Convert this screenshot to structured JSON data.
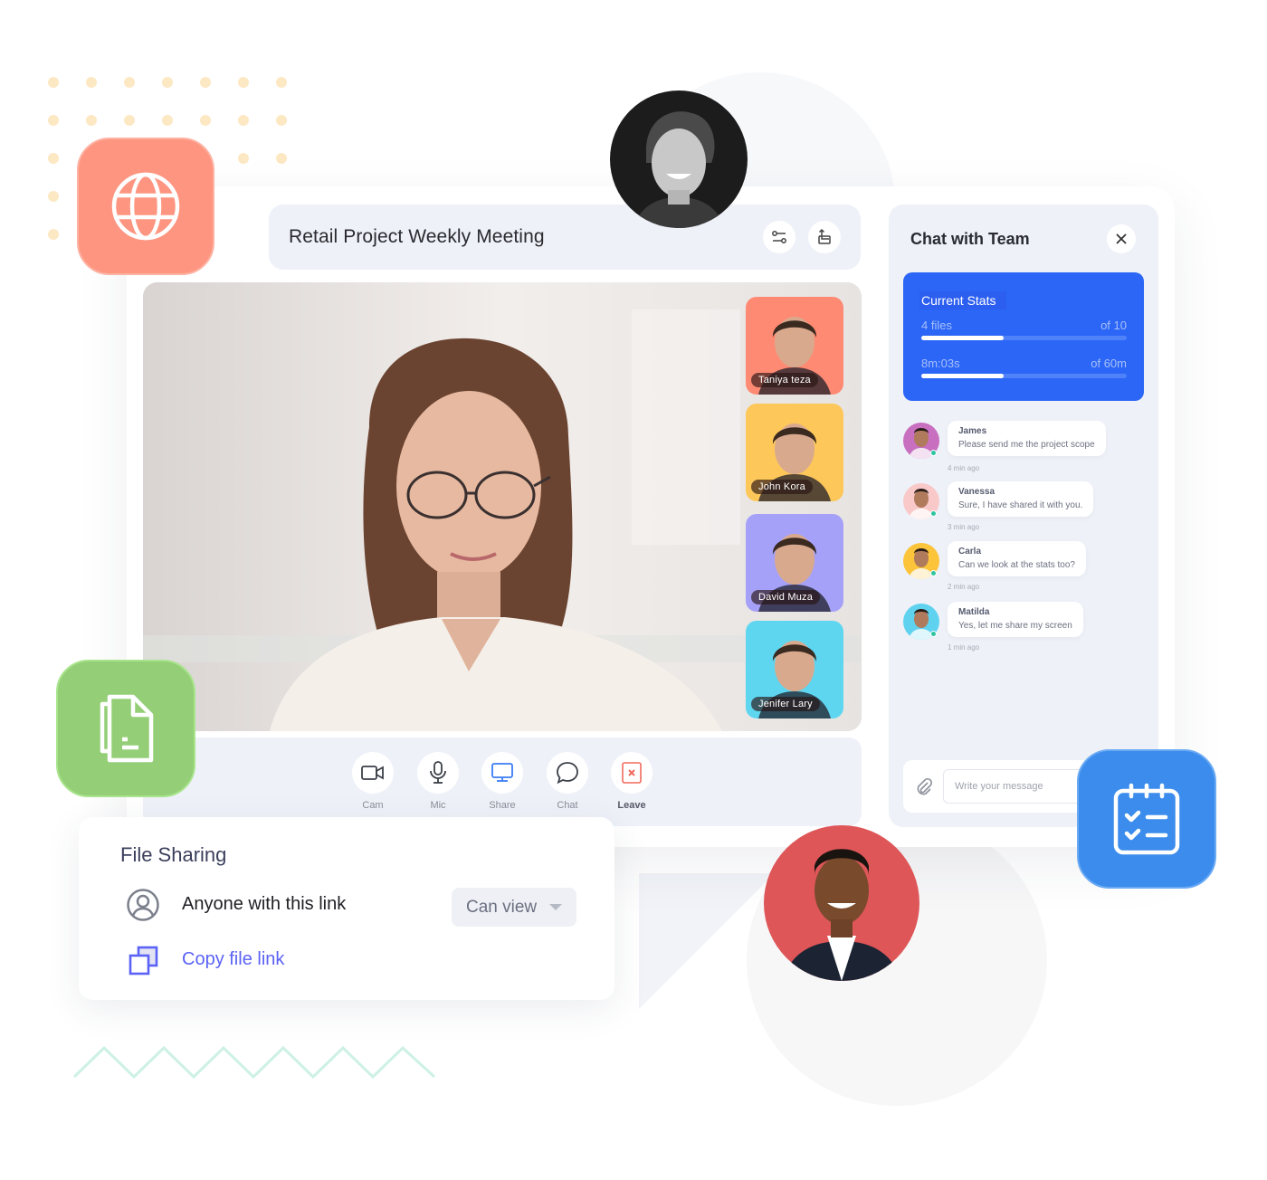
{
  "meeting": {
    "title": "Retail Project Weekly Meeting",
    "header_buttons": [
      {
        "icon": "sliders-icon"
      },
      {
        "icon": "share-export-icon"
      }
    ]
  },
  "participants": [
    {
      "name": "Taniya teza",
      "bg": "#fe8a73"
    },
    {
      "name": "John Kora",
      "bg": "#fdc75a"
    },
    {
      "name": "David Muza",
      "bg": "#a5a1f8"
    },
    {
      "name": "Jenifer Lary",
      "bg": "#5fd6f0"
    }
  ],
  "controls": [
    {
      "label": "Cam",
      "icon": "video-camera-icon"
    },
    {
      "label": "Mic",
      "icon": "microphone-icon"
    },
    {
      "label": "Share",
      "icon": "screen-share-icon",
      "color": "#3b7cf4"
    },
    {
      "label": "Chat",
      "icon": "chat-bubble-icon"
    },
    {
      "label": "Leave",
      "icon": "leave-icon",
      "color": "#f06a5b"
    }
  ],
  "chat": {
    "title": "Chat with Team",
    "stats": {
      "title": "Current Stats",
      "files": {
        "label": "4 files",
        "total_label": "of 10",
        "progress": 0.4
      },
      "time": {
        "label": "8m:03s",
        "total_label": "of 60m",
        "progress": 0.4
      }
    },
    "messages": [
      {
        "name": "James",
        "text": "Please send me the project scope",
        "time": "4 min ago",
        "avatar_bg": "#c86fc0"
      },
      {
        "name": "Vanessa",
        "text": "Sure, I have shared it with you.",
        "time": "3 min ago",
        "avatar_bg": "#f9c9c9"
      },
      {
        "name": "Carla",
        "text": "Can we look at the stats too?",
        "time": "2 min ago",
        "avatar_bg": "#fbc43a"
      },
      {
        "name": "Matilda",
        "text": "Yes, let me share my screen",
        "time": "1 min ago",
        "avatar_bg": "#5fd2ef"
      }
    ],
    "input_placeholder": "Write your message"
  },
  "file_sharing": {
    "title": "File Sharing",
    "access_label": "Anyone with this link",
    "permission": "Can view",
    "copy_link_label": "Copy file link"
  },
  "colors": {
    "globe_tile": "#fe9580",
    "doc_tile": "#94cf77",
    "calendar_tile": "#3b8cec",
    "stats_card": "#2b66f6",
    "copy_link": "#5b62f5"
  }
}
